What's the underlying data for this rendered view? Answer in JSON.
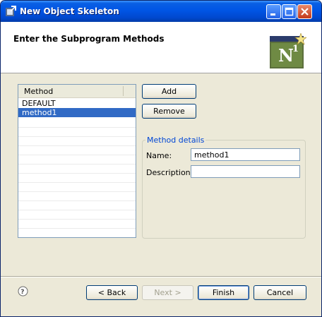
{
  "window": {
    "title": "New Object Skeleton",
    "controls": [
      "minimize",
      "maximize",
      "close"
    ]
  },
  "header": {
    "title": "Enter the Subprogram Methods",
    "logo_text": "N",
    "logo_superscript": "1"
  },
  "methods_table": {
    "column_header": "Method",
    "rows": [
      "DEFAULT",
      "method1"
    ],
    "selected_index": 1
  },
  "buttons": {
    "add": "Add",
    "remove": "Remove",
    "back": "< Back",
    "next": "Next >",
    "finish": "Finish",
    "cancel": "Cancel"
  },
  "method_details": {
    "group_title": "Method details",
    "name_label": "Name:",
    "name_value": "method1",
    "description_label": "Description:",
    "description_value": ""
  },
  "colors": {
    "title_bar": "#0055e5",
    "selection": "#316ac5",
    "group_title": "#0046d5",
    "dialog_bg": "#ece9d8"
  }
}
